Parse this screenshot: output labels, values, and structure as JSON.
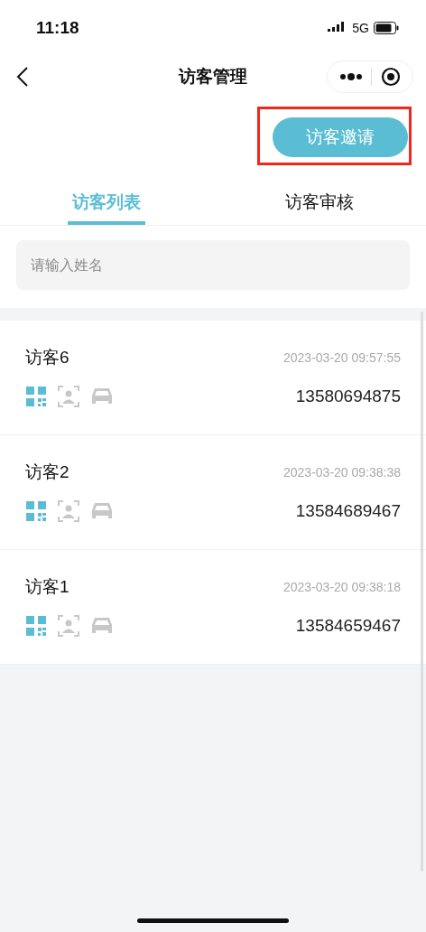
{
  "status_bar": {
    "time": "11:18",
    "network": "5G"
  },
  "nav": {
    "title": "访客管理"
  },
  "invite_button": {
    "label": "访客邀请",
    "highlighted": true
  },
  "tabs": [
    {
      "label": "访客列表",
      "selected": true
    },
    {
      "label": "访客审核",
      "selected": false
    }
  ],
  "search": {
    "placeholder": "请输入姓名"
  },
  "visitors": [
    {
      "name": "访客6",
      "time": "2023-03-20 09:57:55",
      "phone": "13580694875",
      "access": [
        {
          "kind": "qr",
          "on": true
        },
        {
          "kind": "face",
          "on": false
        },
        {
          "kind": "car",
          "on": false
        }
      ]
    },
    {
      "name": "访客2",
      "time": "2023-03-20 09:38:38",
      "phone": "13584689467",
      "access": [
        {
          "kind": "qr",
          "on": true
        },
        {
          "kind": "face",
          "on": false
        },
        {
          "kind": "car",
          "on": false
        }
      ]
    },
    {
      "name": "访客1",
      "time": "2023-03-20 09:38:18",
      "phone": "13584659467",
      "access": [
        {
          "kind": "qr",
          "on": true
        },
        {
          "kind": "face",
          "on": false
        },
        {
          "kind": "car",
          "on": false
        }
      ]
    }
  ]
}
